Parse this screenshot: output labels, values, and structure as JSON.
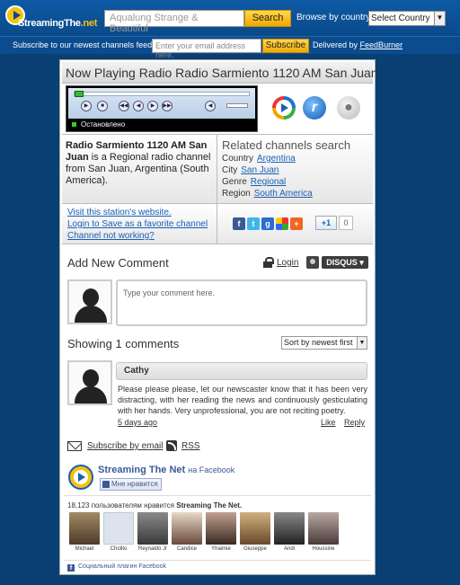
{
  "header": {
    "logo_prefix": "StreamingThe",
    "logo_suffix": ".net",
    "search_placeholder": "Aqualung Strange & Beautiful",
    "search_button": "Search",
    "browse_label": "Browse by country:",
    "country_value": "Select Country"
  },
  "subscribe_bar": {
    "label": "Subscribe to our newest channels feed",
    "email_placeholder": "Enter your email address here.",
    "button": "Subscribe",
    "delivered_prefix": "Delivered by",
    "delivered_link": "FeedBurner"
  },
  "station": {
    "title": "Now Playing Radio Radio Sarmiento 1120 AM San Juan",
    "player_status": "Остановлено",
    "name": "Radio Sarmiento 1120 AM San Juan",
    "description": " is a Regional radio channel from San Juan, Argentina (South America)."
  },
  "related": {
    "title": "Related channels search",
    "country_label": "Country",
    "country_value": "Argentina",
    "city_label": "City",
    "city_value": "San Juan",
    "genre_label": "Genre",
    "genre_value": "Regional",
    "region_label": "Region",
    "region_value": "South America"
  },
  "links": {
    "visit": "Visit this station's website.",
    "favorite": "Login to Save as a favorite channel",
    "not_working": "Channel not working?",
    "gplus": "+1",
    "gplus_count": "0"
  },
  "comments": {
    "add_title": "Add New Comment",
    "login": "Login",
    "disqus": "DISQUS ▾",
    "placeholder": "Type your comment here.",
    "showing": "Showing 1 comments",
    "sort": "Sort by newest first",
    "items": [
      {
        "author": "Cathy",
        "text": "Please please please, let our newscaster know that it has been very distracting, with her reading the news and continuously gesticulating with her hands. Very unprofessional, you are not reciting poetry.",
        "time": "5 days ago",
        "like": "Like",
        "reply": "Reply"
      }
    ],
    "subscribe_email": "Subscribe by email",
    "rss": "RSS"
  },
  "facebook": {
    "page_name": "Streaming The Net",
    "on_facebook": "на Facebook",
    "like_button": "Мне нравится",
    "count_prefix": "18,123 пользователям нравится ",
    "count_page": "Streaming The Net.",
    "fans": [
      "Michael",
      "Cholito",
      "Reynaldo Jr",
      "Candice",
      "Yhaimie",
      "Giuseppe",
      "Andi",
      "Houssine"
    ],
    "footer": "Социальный плагин Facebook",
    "brand_color": "#3b5998"
  }
}
